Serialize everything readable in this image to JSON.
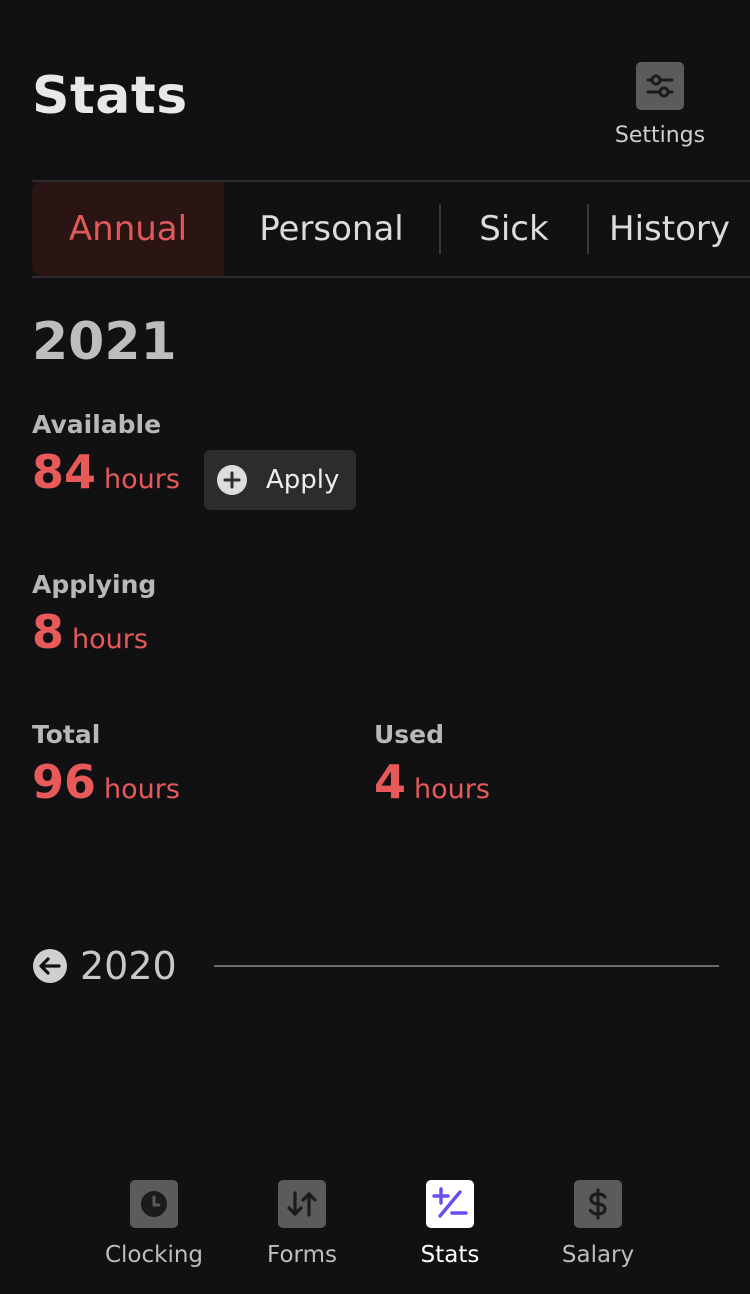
{
  "header": {
    "title": "Stats",
    "settings_label": "Settings"
  },
  "tabs": [
    {
      "label": "Annual",
      "active": true
    },
    {
      "label": "Personal",
      "active": false
    },
    {
      "label": "Sick",
      "active": false
    },
    {
      "label": "History",
      "active": false
    }
  ],
  "year": "2021",
  "stats": {
    "available": {
      "label": "Available",
      "value": "84",
      "unit": "hours"
    },
    "applying": {
      "label": "Applying",
      "value": "8",
      "unit": "hours"
    },
    "total": {
      "label": "Total",
      "value": "96",
      "unit": "hours"
    },
    "used": {
      "label": "Used",
      "value": "4",
      "unit": "hours"
    }
  },
  "apply_button": {
    "label": "Apply"
  },
  "previous_year": {
    "label": "2020"
  },
  "bottom_nav": [
    {
      "label": "Clocking",
      "icon": "clock-icon",
      "active": false
    },
    {
      "label": "Forms",
      "icon": "sort-arrows-icon",
      "active": false
    },
    {
      "label": "Stats",
      "icon": "plus-minus-icon",
      "active": true
    },
    {
      "label": "Salary",
      "icon": "dollar-icon",
      "active": false
    }
  ],
  "colors": {
    "background": "#111113",
    "accent": "#e85a5a",
    "active_tab_bg": "#2a1414",
    "nav_active_icon": "#6a4cf0",
    "icon_box": "#5b5b5e"
  }
}
